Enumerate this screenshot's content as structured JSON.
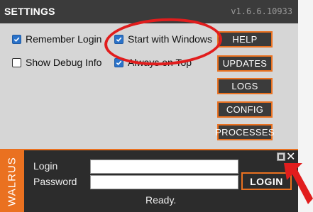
{
  "window": {
    "title": "SETTINGS",
    "version": "v1.6.6.10933"
  },
  "options": [
    {
      "label": "Remember Login",
      "checked": true
    },
    {
      "label": "Start with Windows",
      "checked": true
    },
    {
      "label": "Show Debug Info",
      "checked": false
    },
    {
      "label": "Always on Top",
      "checked": true
    }
  ],
  "buttons": {
    "help": "HELP",
    "updates": "UPDATES",
    "logs": "LOGS",
    "config": "CONFIG",
    "processes": "PROCESSES"
  },
  "login_panel": {
    "brand": "WALRUS",
    "login_label": "Login",
    "password_label": "Password",
    "login_value": "",
    "password_value": "",
    "login_button": "LOGIN",
    "status": "Ready.",
    "close_glyph": "✕"
  },
  "annotations": {
    "highlight_color": "#e11d1d"
  },
  "colors": {
    "accent": "#ea7120",
    "titlebar": "#3b3b3b",
    "panel": "#2c2c2c",
    "body": "#d6d6d6",
    "checkbox_checked": "#2a72c9"
  },
  "icons": [
    "check-icon",
    "minimize-icon",
    "close-icon",
    "arrow-icon"
  ]
}
